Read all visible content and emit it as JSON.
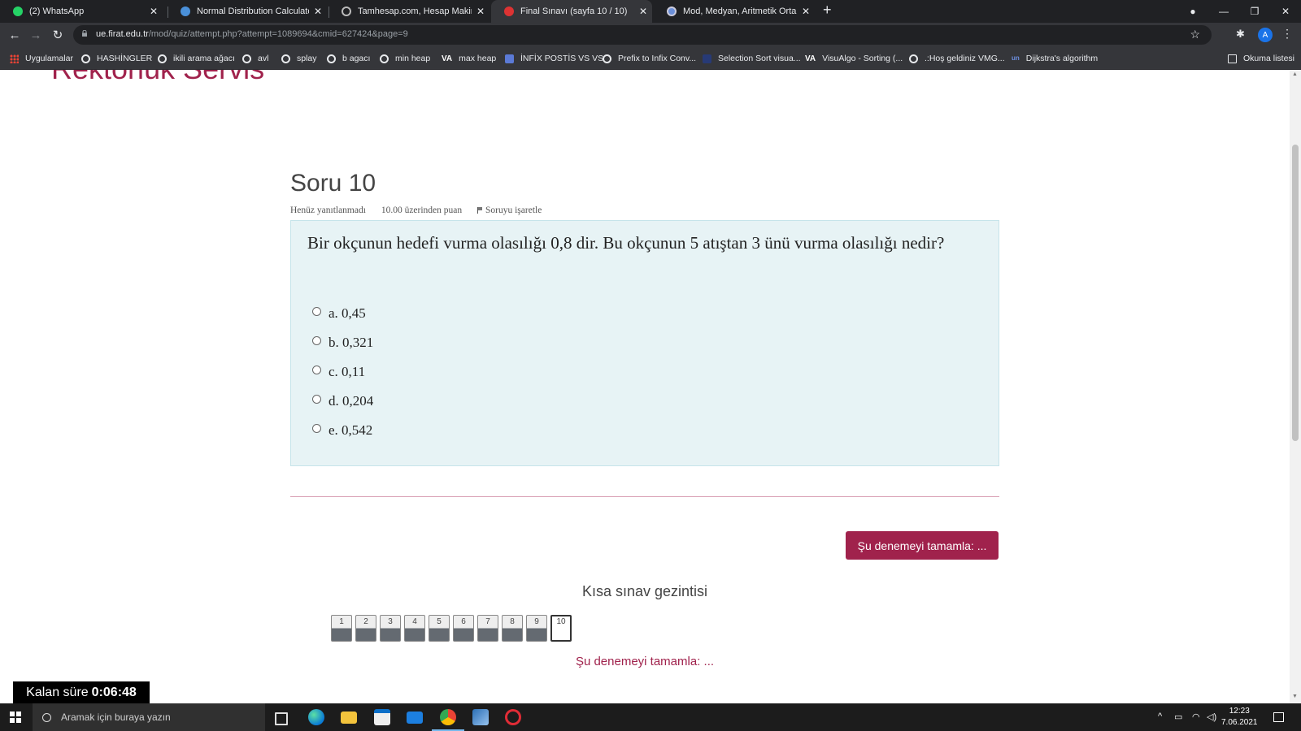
{
  "browser": {
    "tabs": [
      {
        "title": "(2) WhatsApp",
        "icon": "whatsapp-icon",
        "active": false
      },
      {
        "title": "Normal Distribution Calculator | …",
        "icon": "calculator-icon",
        "active": false
      },
      {
        "title": "Tamhesap.com, Hesap Makinesi …",
        "icon": "globe-icon",
        "active": false
      },
      {
        "title": "Final Sınavı (sayfa 10 / 10)",
        "icon": "quiz-icon",
        "active": true
      },
      {
        "title": "Mod, Medyan, Aritmetik Ortalam…",
        "icon": "globe-icon",
        "active": false
      }
    ],
    "new_tab": "+",
    "url_host": "ue.firat.edu.tr",
    "url_path": "/mod/quiz/attempt.php?attempt=1089694&cmid=627424&page=9",
    "profile_initial": "A",
    "bookmarks": [
      {
        "label": "Uygulamalar",
        "icon": "apps-grid-icon"
      },
      {
        "label": "HASHİNGLER",
        "icon": "globe-icon"
      },
      {
        "label": "ikili arama ağacı",
        "icon": "globe-icon"
      },
      {
        "label": "avl",
        "icon": "globe-icon"
      },
      {
        "label": "splay",
        "icon": "globe-icon"
      },
      {
        "label": "b agacı",
        "icon": "globe-icon"
      },
      {
        "label": "min heap",
        "icon": "globe-icon"
      },
      {
        "label": "max heap",
        "icon": "visualgo-icon"
      },
      {
        "label": "İNFİX POSTİS VS VS",
        "icon": "image-icon"
      },
      {
        "label": "Prefix to Infix Conv...",
        "icon": "globe-icon"
      },
      {
        "label": "Selection Sort visua...",
        "icon": "square-icon"
      },
      {
        "label": "VisuAlgo - Sorting (...",
        "icon": "visualgo-icon"
      },
      {
        "label": ".:Hoş geldiniz VMG...",
        "icon": "globe-icon"
      },
      {
        "label": "Dijkstra's algorithm",
        "icon": "usfca-icon"
      }
    ],
    "reading_list": "Okuma listesi"
  },
  "page": {
    "site_title": "Rektörlük Servis",
    "question": {
      "heading": "Soru 10",
      "status": "Henüz yanıtlanmadı",
      "points": "10.00 üzerinden puan",
      "flag_label": "Soruyu işaretle",
      "text": "Bir okçunun hedefi vurma olasılığı 0,8 dir. Bu okçunun 5 atıştan 3 ünü vurma olasılığı nedir?",
      "options": [
        "a. 0,45",
        "b. 0,321",
        "c. 0,11",
        "d. 0,204",
        "e. 0,542"
      ]
    },
    "finish_button": "Şu denemeyi tamamla: ...",
    "navigation": {
      "title": "Kısa sınav gezintisi",
      "pages": [
        "1",
        "2",
        "3",
        "4",
        "5",
        "6",
        "7",
        "8",
        "9",
        "10"
      ],
      "current": "10"
    },
    "finish_link": "Şu denemeyi tamamla: ...",
    "timer_label": "Kalan süre",
    "timer_value": "0:06:48",
    "accent_color": "#a0224c"
  },
  "taskbar": {
    "search_placeholder": "Aramak için buraya yazın",
    "time": "12:23",
    "date": "7.06.2021"
  }
}
